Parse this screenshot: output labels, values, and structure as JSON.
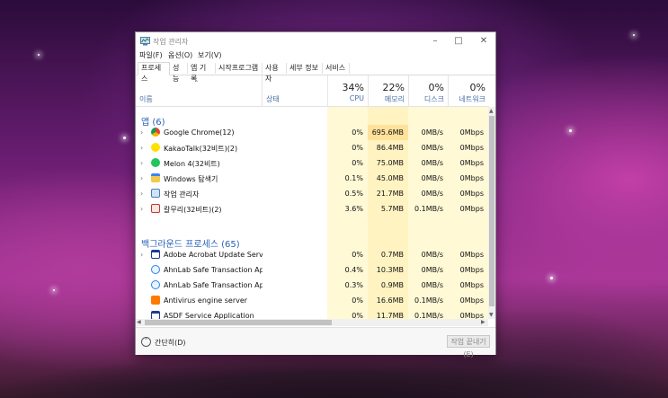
{
  "window": {
    "title": "작업 관리자"
  },
  "menu": [
    "파일(F)",
    "옵션(O)",
    "보기(V)"
  ],
  "tabs": [
    "프로세스",
    "성능",
    "앱 기록",
    "시작프로그램",
    "사용자",
    "세부 정보",
    "서비스"
  ],
  "columns": {
    "name": "이름",
    "status": "상태",
    "cpu": {
      "pct": "34%",
      "label": "CPU"
    },
    "memory": {
      "pct": "22%",
      "label": "메모리"
    },
    "disk": {
      "pct": "0%",
      "label": "디스크"
    },
    "network": {
      "pct": "0%",
      "label": "네트워크"
    }
  },
  "groups": {
    "apps": "앱 (6)",
    "background": "백그라운드 프로세스 (65)"
  },
  "apps": [
    {
      "name": "Google Chrome(12)",
      "cpu": "0%",
      "mem": "695.6MB",
      "disk": "0MB/s",
      "net": "0Mbps",
      "icon": "chrome-icon"
    },
    {
      "name": "KakaoTalk(32비트)(2)",
      "cpu": "0%",
      "mem": "86.4MB",
      "disk": "0MB/s",
      "net": "0Mbps",
      "icon": "kakaotalk-icon"
    },
    {
      "name": "Melon 4(32비트)",
      "cpu": "0%",
      "mem": "75.0MB",
      "disk": "0MB/s",
      "net": "0Mbps",
      "icon": "melon-icon"
    },
    {
      "name": "Windows 탐색기",
      "cpu": "0.1%",
      "mem": "45.0MB",
      "disk": "0MB/s",
      "net": "0Mbps",
      "icon": "explorer-icon"
    },
    {
      "name": "작업 관리자",
      "cpu": "0.5%",
      "mem": "21.7MB",
      "disk": "0MB/s",
      "net": "0Mbps",
      "icon": "task-manager-icon"
    },
    {
      "name": "칼무리(32비트)(2)",
      "cpu": "3.6%",
      "mem": "5.7MB",
      "disk": "0.1MB/s",
      "net": "0Mbps",
      "icon": "kalmuri-icon"
    }
  ],
  "background": [
    {
      "name": "Adobe Acrobat Update Service(...",
      "cpu": "0%",
      "mem": "0.7MB",
      "disk": "0MB/s",
      "net": "0Mbps",
      "icon": "service-window-icon"
    },
    {
      "name": "AhnLab Safe Transaction Appli...",
      "cpu": "0.4%",
      "mem": "10.3MB",
      "disk": "0MB/s",
      "net": "0Mbps",
      "icon": "ahnlab-icon"
    },
    {
      "name": "AhnLab Safe Transaction Appli...",
      "cpu": "0.3%",
      "mem": "0.9MB",
      "disk": "0MB/s",
      "net": "0Mbps",
      "icon": "ahnlab-icon"
    },
    {
      "name": "Antivirus engine server",
      "cpu": "0%",
      "mem": "16.6MB",
      "disk": "0.1MB/s",
      "net": "0Mbps",
      "icon": "antivirus-icon"
    },
    {
      "name": "ASDF Service Application",
      "cpu": "0%",
      "mem": "11.7MB",
      "disk": "0.1MB/s",
      "net": "0Mbps",
      "icon": "asdf-service-icon"
    }
  ],
  "footer": {
    "fewer_details": "간단히(D)",
    "end_task": "작업 끝내기(E)"
  },
  "colors": {
    "cpu_col": "#fff9d6",
    "mem_col": "#fff3c2",
    "mem_highlight": "#ffe29a",
    "group_title": "#2a62b8"
  }
}
